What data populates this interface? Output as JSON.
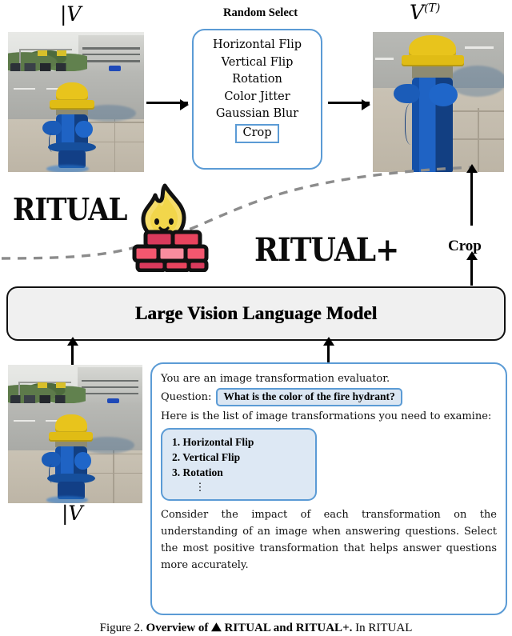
{
  "figure": {
    "caption_prefix": "Figure 2.",
    "caption_bold": "Overview of ⛰ RITUAL and RITUAL+.",
    "caption_rest": " In RITUAL"
  },
  "top_row": {
    "input_label": "|V",
    "output_label": "V",
    "output_superscript": "(T)",
    "random_select": {
      "title": "Random Select",
      "items": [
        "Horizontal Flip",
        "Vertical Flip",
        "Rotation",
        "Color Jitter",
        "Gaussian Blur"
      ],
      "highlighted_item": "Crop"
    }
  },
  "branding": {
    "ritual": "RITUAL",
    "ritual_plus": "RITUAL+",
    "mascot_name": "flame-on-brick-wall-mascot"
  },
  "model": {
    "label": "Large Vision Language Model"
  },
  "crop_path": {
    "label": "Crop"
  },
  "bottom_row": {
    "image_label": "|V",
    "prompt": {
      "intro": "You are an image transformation evaluator.",
      "question_label": "Question:",
      "question_text": "What is the color of the fire hydrant?",
      "list_intro": "Here is the list of image transformations you need to examine:",
      "transformations": [
        "1. Horizontal Flip",
        "2. Vertical Flip",
        "3. Rotation"
      ],
      "ellipsis": "⋮",
      "instruction": "Consider the impact of each transformation on the understanding of an image when answering questions. Select the most positive transformation that helps answer questions more accurately."
    }
  },
  "colors": {
    "accent_blue": "#5b9bd5",
    "chip_fill": "#dbe6f2",
    "list_fill": "#dde8f4",
    "model_fill": "#f0f0f0",
    "dashed_gray": "#8c8c8c",
    "flame_yellow": "#f2d64b",
    "brick_red": "#e8445e"
  }
}
